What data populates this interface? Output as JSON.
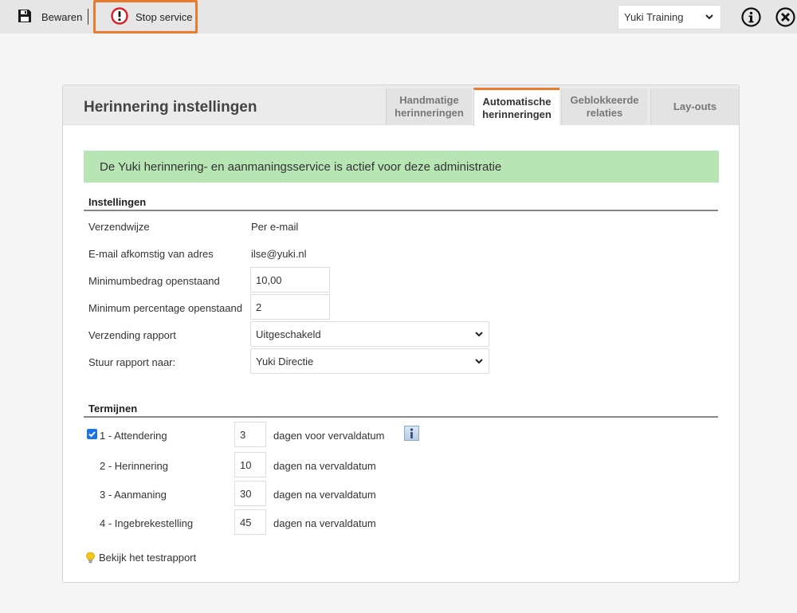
{
  "toolbar": {
    "save_label": "Bewaren",
    "stop_label": "Stop service",
    "administration": "Yuki Training",
    "colors": {
      "highlight": "#e87b2e",
      "stop_icon": "#d9232a"
    }
  },
  "panel": {
    "title": "Herinnering instellingen",
    "tabs": [
      {
        "label": "Handmatige herinneringen",
        "active": false
      },
      {
        "label": "Automatische herinneringen",
        "active": true
      },
      {
        "label": "Geblokkeerde relaties",
        "active": false
      },
      {
        "label": "Lay-outs",
        "active": false
      }
    ],
    "banner": "De Yuki herinnering- en aanmaningsservice is actief voor deze administratie"
  },
  "settings": {
    "title": "Instellingen",
    "shipping_label": "Verzendwijze",
    "shipping_value": "Per e-mail",
    "from_label": "E-mail afkomstig van adres",
    "from_value": "ilse@yuki.nl",
    "min_amount_label": "Minimumbedrag openstaand",
    "min_amount_value": "10,00",
    "min_pct_label": "Minimum percentage openstaand",
    "min_pct_value": "2",
    "report_label": "Verzending rapport",
    "report_value": "Uitgeschakeld",
    "send_to_label": "Stuur rapport naar:",
    "send_to_value": "Yuki Directie"
  },
  "terms": {
    "title": "Termijnen",
    "rows": [
      {
        "label": "1 - Attendering",
        "days": "3",
        "suffix": "dagen voor vervaldatum",
        "checked": true
      },
      {
        "label": "2 - Herinnering",
        "days": "10",
        "suffix": "dagen na vervaldatum"
      },
      {
        "label": "3 - Aanmaning",
        "days": "30",
        "suffix": "dagen na vervaldatum"
      },
      {
        "label": "4 - Ingebrekestelling",
        "days": "45",
        "suffix": "dagen na vervaldatum"
      }
    ],
    "test_report": "Bekijk het testrapport"
  }
}
